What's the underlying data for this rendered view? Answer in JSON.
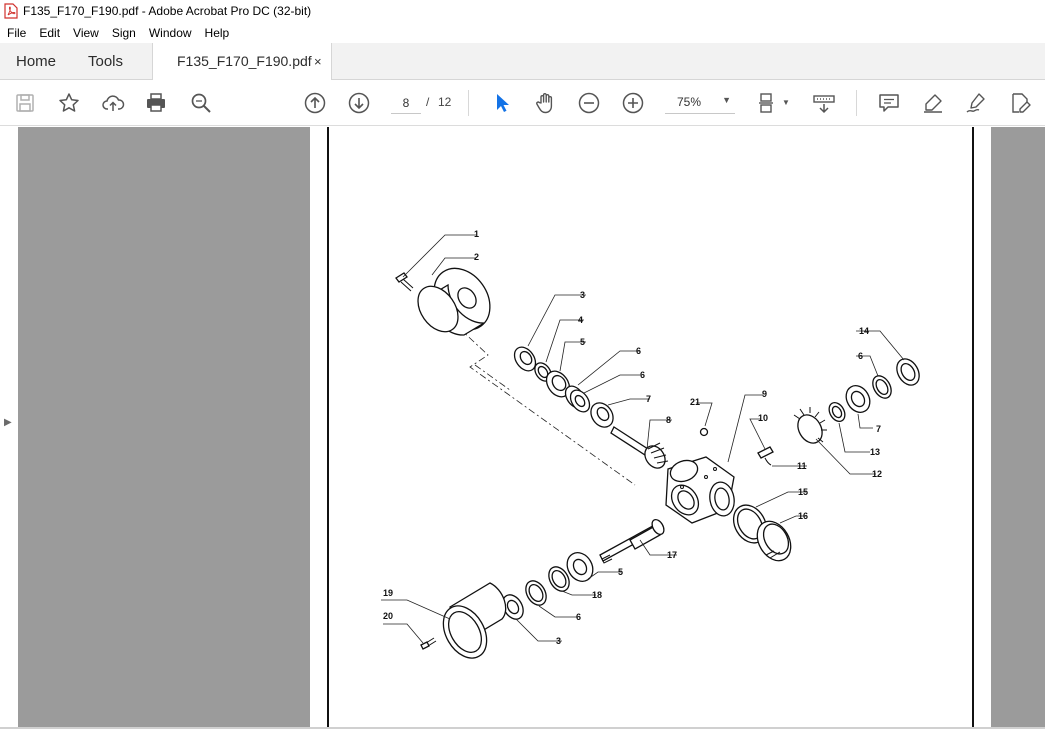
{
  "window": {
    "title": "F135_F170_F190.pdf - Adobe Acrobat Pro DC (32-bit)"
  },
  "menu": [
    "File",
    "Edit",
    "View",
    "Sign",
    "Window",
    "Help"
  ],
  "tabs": {
    "home": "Home",
    "tools": "Tools",
    "document": "F135_F170_F190.pdf",
    "close": "×"
  },
  "toolbar": {
    "page_current": "8",
    "page_separator": "/",
    "page_total": "12",
    "zoom": "75%",
    "icons": [
      "save-icon",
      "bookmark-star-icon",
      "upload-icon",
      "print-icon",
      "find-icon",
      "previous-page-icon",
      "next-page-icon",
      "select-cursor-icon",
      "hand-icon",
      "zoom-out-icon",
      "zoom-in-icon",
      "page-display-icon",
      "scroll-mode-icon",
      "comment-icon",
      "highlight-icon",
      "sign-icon",
      "edit-pdf-icon"
    ],
    "accent": "#1473e6"
  },
  "diagram": {
    "callouts": {
      "c1": "1",
      "c2": "2",
      "c3a": "3",
      "c4": "4",
      "c5a": "5",
      "c6a": "6",
      "c6b": "6",
      "c7a": "7",
      "c8": "8",
      "c9": "9",
      "c10": "10",
      "c11": "11",
      "c12": "12",
      "c13": "13",
      "c14": "14",
      "c6c": "6",
      "c7b": "7",
      "c15": "15",
      "c16": "16",
      "c17": "17",
      "c21": "21",
      "c5b": "5",
      "c18": "18",
      "c6d": "6",
      "c3b": "3",
      "c19": "19",
      "c20": "20"
    }
  },
  "colors": {
    "workspace_gray": "#9b9b9b",
    "tabbar": "#f2f2f2"
  }
}
